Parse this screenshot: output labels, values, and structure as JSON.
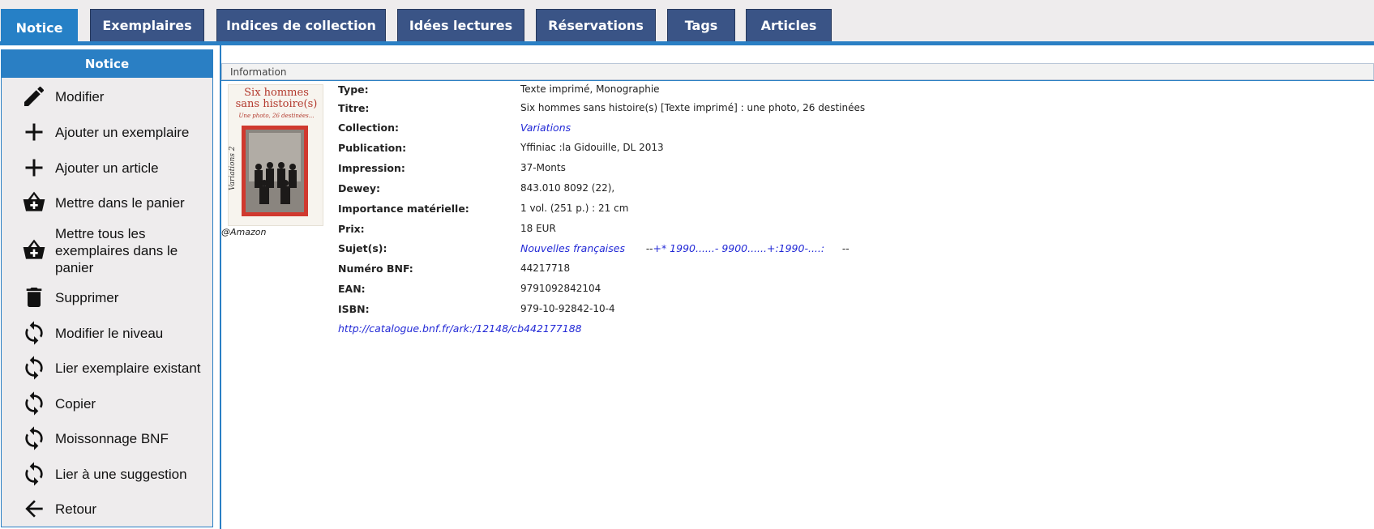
{
  "tabs": [
    {
      "label": "Notice",
      "active": true
    },
    {
      "label": "Exemplaires"
    },
    {
      "label": "Indices de collection"
    },
    {
      "label": "Idées lectures"
    },
    {
      "label": "Réservations"
    },
    {
      "label": "Tags"
    },
    {
      "label": "Articles"
    }
  ],
  "sidebar": {
    "title": "Notice",
    "items": [
      {
        "label": "Modifier",
        "icon": "pencil-icon"
      },
      {
        "label": "Ajouter un exemplaire",
        "icon": "plus-icon"
      },
      {
        "label": "Ajouter un article",
        "icon": "plus-icon"
      },
      {
        "label": "Mettre dans le panier",
        "icon": "basket-icon"
      },
      {
        "label": "Mettre tous les exemplaires dans le panier",
        "icon": "basket-icon"
      },
      {
        "label": "Supprimer",
        "icon": "trash-icon"
      },
      {
        "label": "Modifier le niveau",
        "icon": "refresh-icon"
      },
      {
        "label": "Lier exemplaire existant",
        "icon": "refresh-icon"
      },
      {
        "label": "Copier",
        "icon": "refresh-icon"
      },
      {
        "label": "Moissonnage BNF",
        "icon": "refresh-icon"
      },
      {
        "label": "Lier à une suggestion",
        "icon": "refresh-icon"
      },
      {
        "label": "Retour",
        "icon": "arrow-left-icon"
      }
    ]
  },
  "info_section": {
    "title": "Information"
  },
  "cover": {
    "title_line1": "Six hommes",
    "title_line2": "sans histoire(s)",
    "subtitle": "Une photo, 26 destinées...",
    "side_text": "Variations 2",
    "credit": "@Amazon"
  },
  "fields": {
    "type_label": "Type:",
    "type_value": "Texte imprimé, Monographie",
    "titre_label": "Titre:",
    "titre_value": "Six hommes sans histoire(s) [Texte imprimé] : une photo, 26 destinées",
    "collection_label": "Collection:",
    "collection_value": "Variations",
    "publication_label": "Publication:",
    "publication_value": "Yffiniac :la Gidouille, DL 2013",
    "impression_label": "Impression:",
    "impression_value": "37-Monts",
    "dewey_label": "Dewey:",
    "dewey_value": "843.010 8092 (22),",
    "importance_label": "Importance matérielle:",
    "importance_value": "1 vol. (251 p.) : 21 cm",
    "prix_label": "Prix:",
    "prix_value": "18 EUR",
    "sujets_label": "Sujet(s):",
    "sujets_value1": "Nouvelles françaises",
    "sujets_sep1": "--",
    "sujets_value2": "+* 1990......- 9900......+:1990-....:",
    "sujets_sep2": "--",
    "bnf_label": "Numéro BNF:",
    "bnf_value": "44217718",
    "ean_label": "EAN:",
    "ean_value": "9791092842104",
    "isbn_label": "ISBN:",
    "isbn_value": "979-10-92842-10-4",
    "link_url": "http://catalogue.bnf.fr/ark:/12148/cb442177188"
  },
  "colors": {
    "tab": "#3a5486",
    "active_tab": "#2680c6",
    "accent": "#2a7fc4",
    "link": "#2229d6"
  }
}
